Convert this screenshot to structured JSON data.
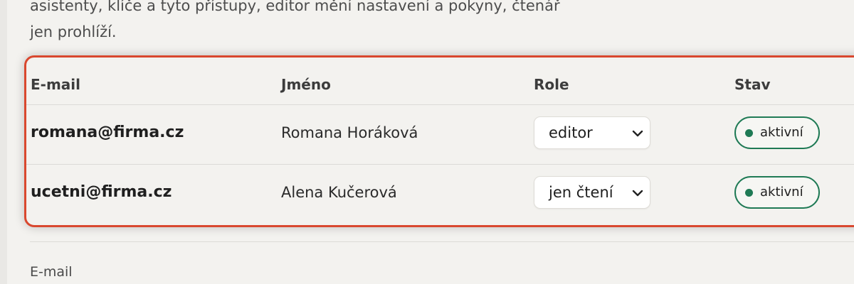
{
  "intro": {
    "line1": "asistenty, klíče a tyto přístupy, editor mění nastavení a pokyny, čtenář",
    "line2": "jen prohlíží."
  },
  "table": {
    "headers": {
      "email": "E-mail",
      "name": "Jméno",
      "role": "Role",
      "status": "Stav"
    },
    "rows": [
      {
        "email": "romana@firma.cz",
        "name": "Romana Horáková",
        "role": "editor",
        "status": "aktivní"
      },
      {
        "email": "ucetni@firma.cz",
        "name": "Alena Kučerová",
        "role": "jen čtení",
        "status": "aktivní"
      }
    ]
  },
  "form": {
    "email_label": "E-mail"
  },
  "colors": {
    "highlight_border": "#d9482f",
    "status_active": "#1f7a55"
  },
  "icons": {
    "select_arrow": "chevron-down-icon",
    "status_dot": "status-dot-icon"
  }
}
